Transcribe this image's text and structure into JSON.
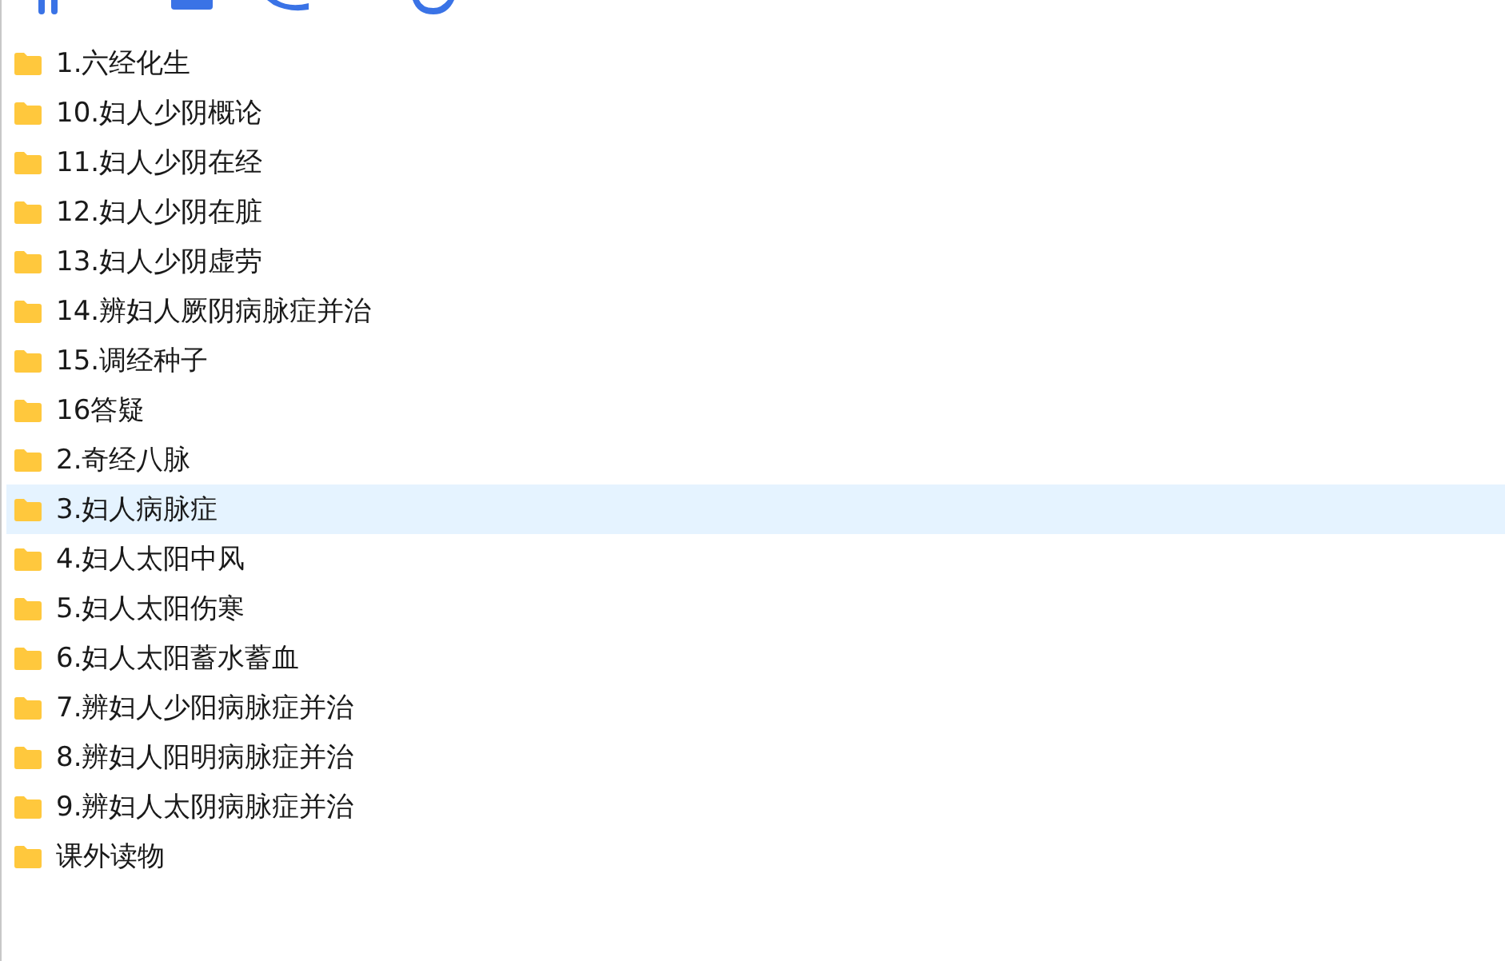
{
  "folders": [
    {
      "name": "1.六经化生",
      "selected": false
    },
    {
      "name": "10.妇人少阴概论",
      "selected": false
    },
    {
      "name": "11.妇人少阴在经",
      "selected": false
    },
    {
      "name": "12.妇人少阴在脏",
      "selected": false
    },
    {
      "name": "13.妇人少阴虚劳",
      "selected": false
    },
    {
      "name": "14.辨妇人厥阴病脉症并治",
      "selected": false
    },
    {
      "name": "15.调经种子",
      "selected": false
    },
    {
      "name": "16答疑",
      "selected": false
    },
    {
      "name": "2.奇经八脉",
      "selected": false
    },
    {
      "name": "3.妇人病脉症",
      "selected": true
    },
    {
      "name": "4.妇人太阳中风",
      "selected": false
    },
    {
      "name": "5.妇人太阳伤寒",
      "selected": false
    },
    {
      "name": "6.妇人太阳蓄水蓄血",
      "selected": false
    },
    {
      "name": "7.辨妇人少阳病脉症并治",
      "selected": false
    },
    {
      "name": "8.辨妇人阳明病脉症并治",
      "selected": false
    },
    {
      "name": "9.辨妇人太阴病脉症并治",
      "selected": false
    },
    {
      "name": "课外读物",
      "selected": false
    }
  ]
}
